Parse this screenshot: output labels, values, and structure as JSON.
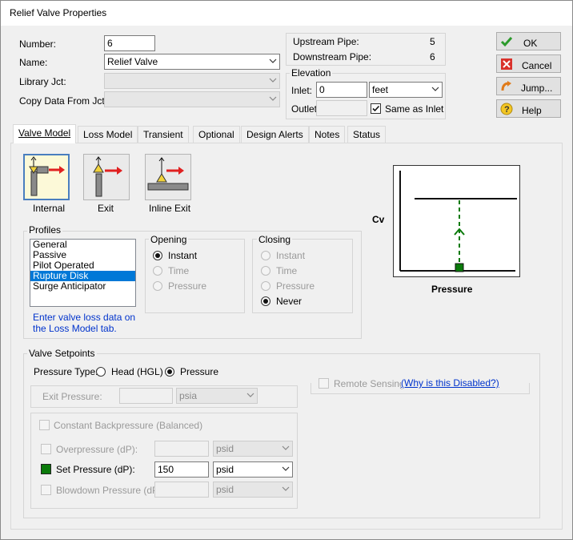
{
  "window": {
    "title": "Relief Valve Properties"
  },
  "fields": {
    "number_label": "Number:",
    "number_value": "6",
    "name_label": "Name:",
    "name_value": "Relief Valve",
    "library_label": "Library Jct:",
    "library_value": "",
    "copy_label": "Copy Data From Jct...",
    "copy_value": ""
  },
  "pipes": {
    "upstream_label": "Upstream Pipe:",
    "upstream_value": "5",
    "downstream_label": "Downstream Pipe:",
    "downstream_value": "6"
  },
  "elevation": {
    "group_label": "Elevation",
    "inlet_label": "Inlet:",
    "inlet_value": "0",
    "inlet_unit": "feet",
    "outlet_label": "Outlet:",
    "outlet_value": "",
    "same_as_inlet_label": "Same as Inlet",
    "same_as_inlet_checked": true
  },
  "buttons": {
    "ok": "OK",
    "cancel": "Cancel",
    "jump": "Jump...",
    "help": "Help"
  },
  "tabs": [
    {
      "label": "Valve Model",
      "active": true
    },
    {
      "label": "Loss Model"
    },
    {
      "label": "Transient"
    },
    {
      "label": "Optional"
    },
    {
      "label": "Design Alerts"
    },
    {
      "label": "Notes"
    },
    {
      "label": "Status"
    }
  ],
  "valve_types": [
    {
      "label": "Internal",
      "selected": true
    },
    {
      "label": "Exit"
    },
    {
      "label": "Inline Exit"
    }
  ],
  "profiles": {
    "group_label": "Profiles",
    "items": [
      "General",
      "Passive",
      "Pilot Operated",
      "Rupture Disk",
      "Surge Anticipator"
    ],
    "selected": "Rupture Disk",
    "note": "Enter valve loss data on the Loss Model tab."
  },
  "opening": {
    "group_label": "Opening",
    "options": [
      "Instant",
      "Time",
      "Pressure"
    ],
    "selected": "Instant"
  },
  "closing": {
    "group_label": "Closing",
    "options": [
      "Instant",
      "Time",
      "Pressure",
      "Never"
    ],
    "selected": "Never"
  },
  "graph": {
    "y_label": "Cv",
    "x_label": "Pressure"
  },
  "setpoints": {
    "group_label": "Valve Setpoints",
    "pressure_type_label": "Pressure Type:",
    "pressure_type_options": [
      "Head (HGL)",
      "Pressure"
    ],
    "pressure_type_selected": "Pressure",
    "remote_sensing_label": "Remote Sensing",
    "remote_sensing_link": "(Why is this Disabled?)",
    "exit_pressure_label": "Exit Pressure:",
    "exit_pressure_value": "",
    "exit_pressure_unit": "psia",
    "constant_backpressure_label": "Constant Backpressure (Balanced)",
    "overpressure_label": "Overpressure (dP):",
    "overpressure_value": "",
    "overpressure_unit": "psid",
    "set_pressure_label": "Set Pressure (dP):",
    "set_pressure_value": "150",
    "set_pressure_unit": "psid",
    "blowdown_label": "Blowdown Pressure (dP):",
    "blowdown_value": "",
    "blowdown_unit": "psid"
  },
  "colors": {
    "accent_green": "#0a7a0a",
    "selection_blue": "#0078d7",
    "arrow_red": "#e02020"
  }
}
